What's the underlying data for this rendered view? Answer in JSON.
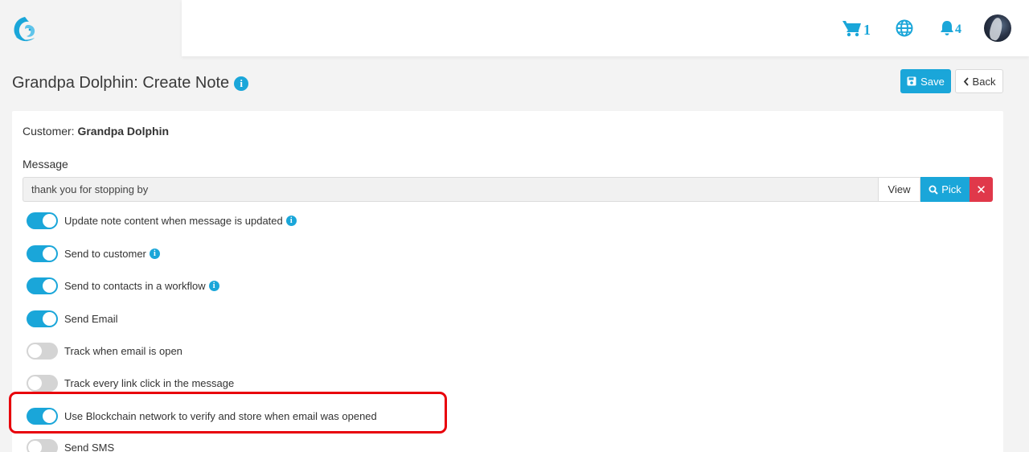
{
  "topbar": {
    "cart_count": "1",
    "notifications_count": "4"
  },
  "page": {
    "title": "Grandpa Dolphin: Create Note",
    "save_label": "Save",
    "back_label": "Back"
  },
  "form": {
    "customer_label": "Customer:",
    "customer_name": "Grandpa Dolphin",
    "message_label": "Message",
    "message_value": "thank you for stopping by",
    "view_label": "View",
    "pick_label": "Pick",
    "toggles": [
      {
        "label": "Update note content when message is updated",
        "on": true,
        "info": true
      },
      {
        "label": "Send to customer",
        "on": true,
        "info": true
      },
      {
        "label": "Send to contacts in a workflow",
        "on": true,
        "info": true
      },
      {
        "label": "Send Email",
        "on": true,
        "info": false
      },
      {
        "label": "Track when email is open",
        "on": false,
        "info": false
      },
      {
        "label": "Track every link click in the message",
        "on": false,
        "info": false
      },
      {
        "label": "Use Blockchain network to verify and store when email was opened",
        "on": true,
        "info": false
      },
      {
        "label": "Send SMS",
        "on": false,
        "info": false
      }
    ]
  },
  "colors": {
    "accent": "#1aa6d9",
    "danger": "#e0384a",
    "highlight": "#e8000b"
  },
  "icons": [
    "logo-icon",
    "cart-icon",
    "globe-icon",
    "bell-icon",
    "info-icon",
    "save-icon",
    "chevron-left-icon",
    "search-icon",
    "close-icon"
  ]
}
